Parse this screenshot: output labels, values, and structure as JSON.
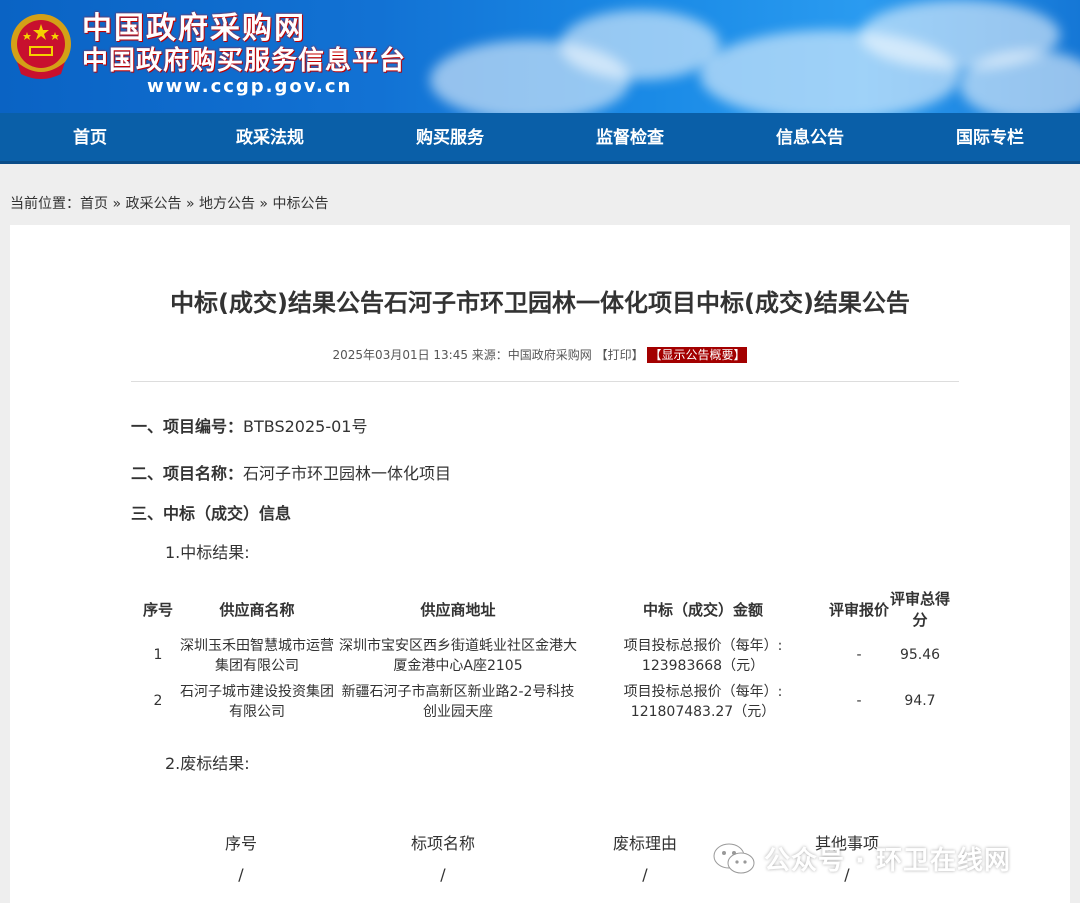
{
  "header": {
    "site_title": "中国政府采购网",
    "site_subtitle": "中国政府购买服务信息平台",
    "site_url": "www.ccgp.gov.cn"
  },
  "nav": {
    "items": [
      "首页",
      "政采法规",
      "购买服务",
      "监督检查",
      "信息公告",
      "国际专栏"
    ]
  },
  "breadcrumb": {
    "prefix": "当前位置：",
    "items": [
      "首页",
      "政采公告",
      "地方公告",
      "中标公告"
    ],
    "sep": "»"
  },
  "article": {
    "title": "中标(成交)结果公告石河子市环卫园林一体化项目中标(成交)结果公告",
    "meta_text": "2025年03月01日 13:45 来源：中国政府采购网 【打印】",
    "summary_badge": "【显示公告概要】",
    "project_no_label": "一、项目编号：",
    "project_no": "BTBS2025-01号",
    "project_name_label": "二、项目名称：",
    "project_name": "石河子市环卫园林一体化项目",
    "winner_info_label": "三、中标（成交）信息",
    "result_label": "1.中标结果:",
    "fail_label": "2.废标结果:"
  },
  "result_table": {
    "headers": [
      "序号",
      "供应商名称",
      "供应商地址",
      "中标（成交）金额",
      "评审报价",
      "评审总得分"
    ],
    "rows": [
      {
        "no": "1",
        "supplier": "深圳玉禾田智慧城市运营集团有限公司",
        "address": "深圳市宝安区西乡街道蚝业社区金港大厦金港中心A座2105",
        "amount_1": "项目投标总报价（每年）:",
        "amount_2": "123983668（元）",
        "quote": "-",
        "score": "95.46"
      },
      {
        "no": "2",
        "supplier": "石河子城市建设投资集团有限公司",
        "address": "新疆石河子市高新区新业路2-2号科技创业园天座",
        "amount_1": "项目投标总报价（每年）:",
        "amount_2": "121807483.27（元）",
        "quote": "-",
        "score": "94.7"
      }
    ]
  },
  "fail_table": {
    "headers": [
      "序号",
      "标项名称",
      "废标理由",
      "其他事项"
    ],
    "values": [
      "/",
      "/",
      "/",
      "/"
    ]
  },
  "watermark": {
    "text": "公众号 · 环卫在线网",
    "icon": "wechat-icon"
  }
}
